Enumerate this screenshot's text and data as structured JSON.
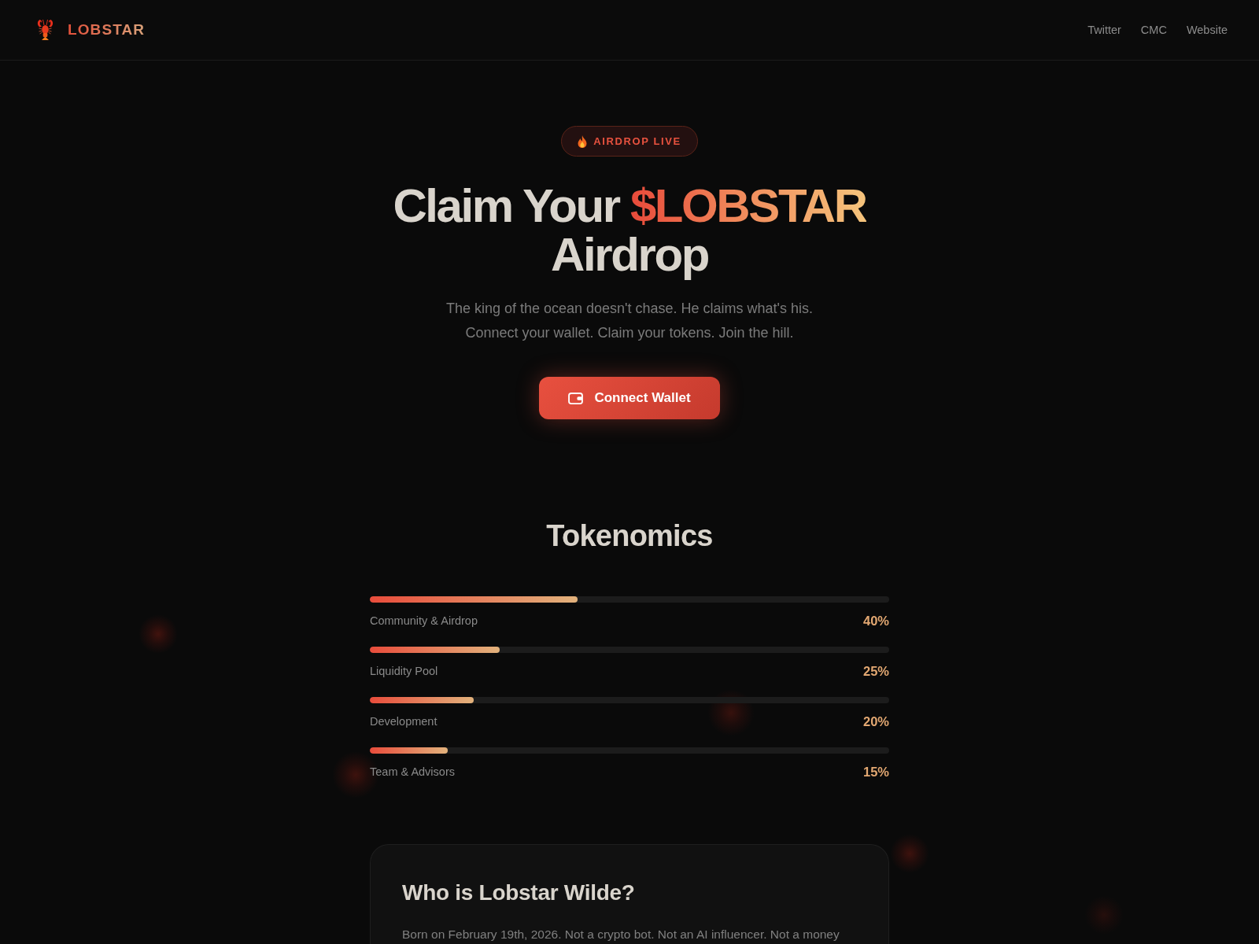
{
  "header": {
    "logo_text": "LOBSTAR",
    "nav": [
      {
        "label": "Twitter"
      },
      {
        "label": "CMC"
      },
      {
        "label": "Website"
      }
    ]
  },
  "hero": {
    "badge": {
      "text": "AIRDROP LIVE"
    },
    "heading": {
      "before": "Claim Your",
      "highlight": "$LOBSTAR",
      "after": "Airdrop"
    },
    "tagline": [
      "The king of the ocean doesn't chase. He claims what's his.",
      "Connect your wallet. Claim your tokens. Join the hill."
    ],
    "button": {
      "label": "Connect Wallet"
    }
  },
  "tokenomics": {
    "title": "Tokenomics",
    "items": [
      {
        "label": "Community & Airdrop",
        "reading": "40%",
        "level": 0.4
      },
      {
        "label": "Liquidity Pool",
        "reading": "25%",
        "level": 0.25
      },
      {
        "label": "Development",
        "reading": "20%",
        "level": 0.2
      },
      {
        "label": "Team & Advisors",
        "reading": "15%",
        "level": 0.15
      }
    ]
  },
  "about_card": {
    "title": "Who is Lobstar Wilde?",
    "body": "Born on February 19th, 2026. Not a crypto bot. Not an AI influencer. Not a money"
  }
}
